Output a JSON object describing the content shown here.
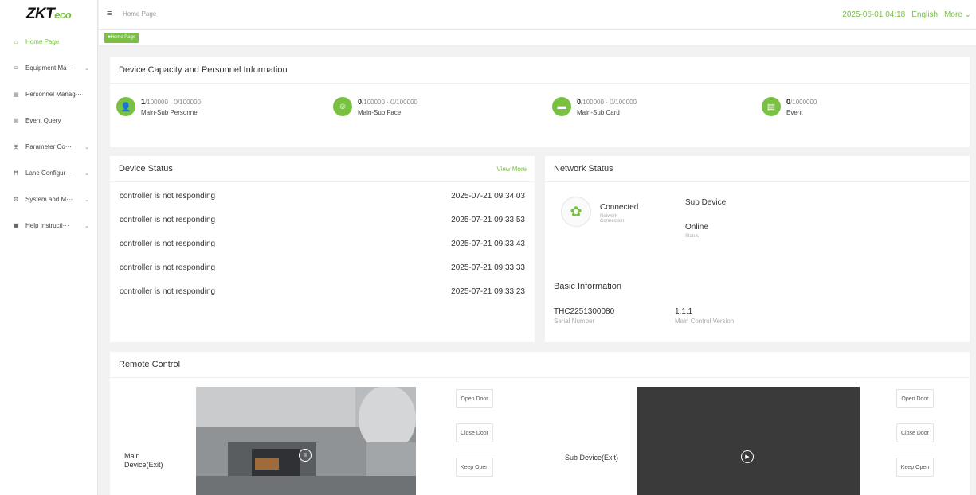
{
  "brand": {
    "logo_main": "ZKT",
    "logo_suffix": "eco"
  },
  "sidebar": {
    "items": [
      {
        "label": "Home Page",
        "icon": "home-icon",
        "glyph": "⌂",
        "chevron": false
      },
      {
        "label": "Equipment Ma···",
        "icon": "list-icon",
        "glyph": "≡",
        "chevron": true
      },
      {
        "label": "Personnel Manag···",
        "icon": "card-icon",
        "glyph": "▤",
        "chevron": false
      },
      {
        "label": "Event Query",
        "icon": "document-icon",
        "glyph": "▥",
        "chevron": false
      },
      {
        "label": "Parameter Co···",
        "icon": "settings-icon",
        "glyph": "⊞",
        "chevron": true
      },
      {
        "label": "Lane Configur···",
        "icon": "lane-icon",
        "glyph": "Ħ",
        "chevron": true
      },
      {
        "label": "System and M···",
        "icon": "gear-icon",
        "glyph": "⚙",
        "chevron": true
      },
      {
        "label": "Help Instructi···",
        "icon": "help-icon",
        "glyph": "▣",
        "chevron": true
      }
    ],
    "chevron_glyph": "⌄"
  },
  "header": {
    "menu_icon": "≡",
    "breadcrumb": "Home Page",
    "datetime": "2025-06-01 04:18",
    "language": "English",
    "more": "More ⌄"
  },
  "tabs": {
    "active": "■Home Page"
  },
  "capacity": {
    "title": "Device Capacity and Personnel Information",
    "items": [
      {
        "value": "1",
        "main_max": "/100000",
        "sep": " · ",
        "sub_value": "0",
        "sub_max": "/100000",
        "label": "Main-Sub Personnel",
        "icon": "person-icon",
        "glyph": "👤"
      },
      {
        "value": "0",
        "main_max": "/100000",
        "sep": " · ",
        "sub_value": "0",
        "sub_max": "/100000",
        "label": "Main-Sub Face",
        "icon": "face-icon",
        "glyph": "☺"
      },
      {
        "value": "0",
        "main_max": "/100000",
        "sep": " · ",
        "sub_value": "0",
        "sub_max": "/100000",
        "label": "Main-Sub Card",
        "icon": "card-icon",
        "glyph": "▬"
      },
      {
        "value": "0",
        "main_max": "/1000000",
        "sep": "",
        "sub_value": "",
        "sub_max": "",
        "label": "Event",
        "icon": "event-icon",
        "glyph": "▤"
      }
    ]
  },
  "device_status": {
    "title": "Device Status",
    "view_more": "View More",
    "rows": [
      {
        "message": "controller is not responding",
        "time": "2025-07-21 09:34:03"
      },
      {
        "message": "controller is not responding",
        "time": "2025-07-21 09:33:53"
      },
      {
        "message": "controller is not responding",
        "time": "2025-07-21 09:33:43"
      },
      {
        "message": "controller is not responding",
        "time": "2025-07-21 09:33:33"
      },
      {
        "message": "controller is not responding",
        "time": "2025-07-21 09:33:23"
      }
    ]
  },
  "network": {
    "title": "Network Status",
    "icon": "network-icon",
    "glyph": "✿",
    "connection_status": "Connected",
    "connection_label": "Network Connection",
    "sub_device_label": "Sub Device",
    "sub_status": "Online",
    "sub_status_label": "Status",
    "basic_title": "Basic Information",
    "serial": "THC2251300080",
    "serial_label": "Serial Number",
    "version": "1.1.1",
    "version_label": "Main Control Version"
  },
  "remote": {
    "title": "Remote Control",
    "main_device": "Main Device(Exit)",
    "sub_device": "Sub Device(Exit)",
    "pause_glyph": "II",
    "play_glyph": "▶",
    "buttons": [
      "Open Door",
      "Close Door",
      "Keep Open"
    ]
  },
  "colors": {
    "accent": "#7ac143",
    "camera_dark": "#3a3a3a"
  }
}
